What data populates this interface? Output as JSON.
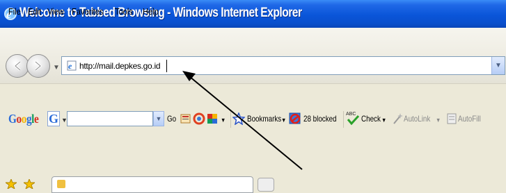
{
  "window": {
    "title": "Welcome to Tabbed Browsing - Windows Internet Explorer"
  },
  "navigation": {
    "back_icon": "back-arrow-icon",
    "forward_icon": "forward-arrow-icon",
    "address": {
      "url": "http://mail.depkes.go.id",
      "page_icon": "ie-page-icon"
    }
  },
  "menubar": {
    "items": [
      "File",
      "Edit",
      "View",
      "Favorites",
      "Tools",
      "Help"
    ]
  },
  "google_toolbar": {
    "logo_letters": [
      "G",
      "o",
      "o",
      "g",
      "l",
      "e"
    ],
    "logo_colors": [
      "#2a6bd8",
      "#d62d20",
      "#f4b400",
      "#2a6bd8",
      "#109d58",
      "#d62d20"
    ],
    "g_button": "G",
    "go_label": "Go",
    "bookmarks_label": "Bookmarks",
    "blocked_label": "28 blocked",
    "check_label": "Check",
    "autolink_label": "AutoLink",
    "autofill_label": "AutoFill"
  },
  "tabs": {
    "visible_tab_title": ""
  },
  "annotation": {
    "type": "arrow",
    "color": "#000000"
  }
}
